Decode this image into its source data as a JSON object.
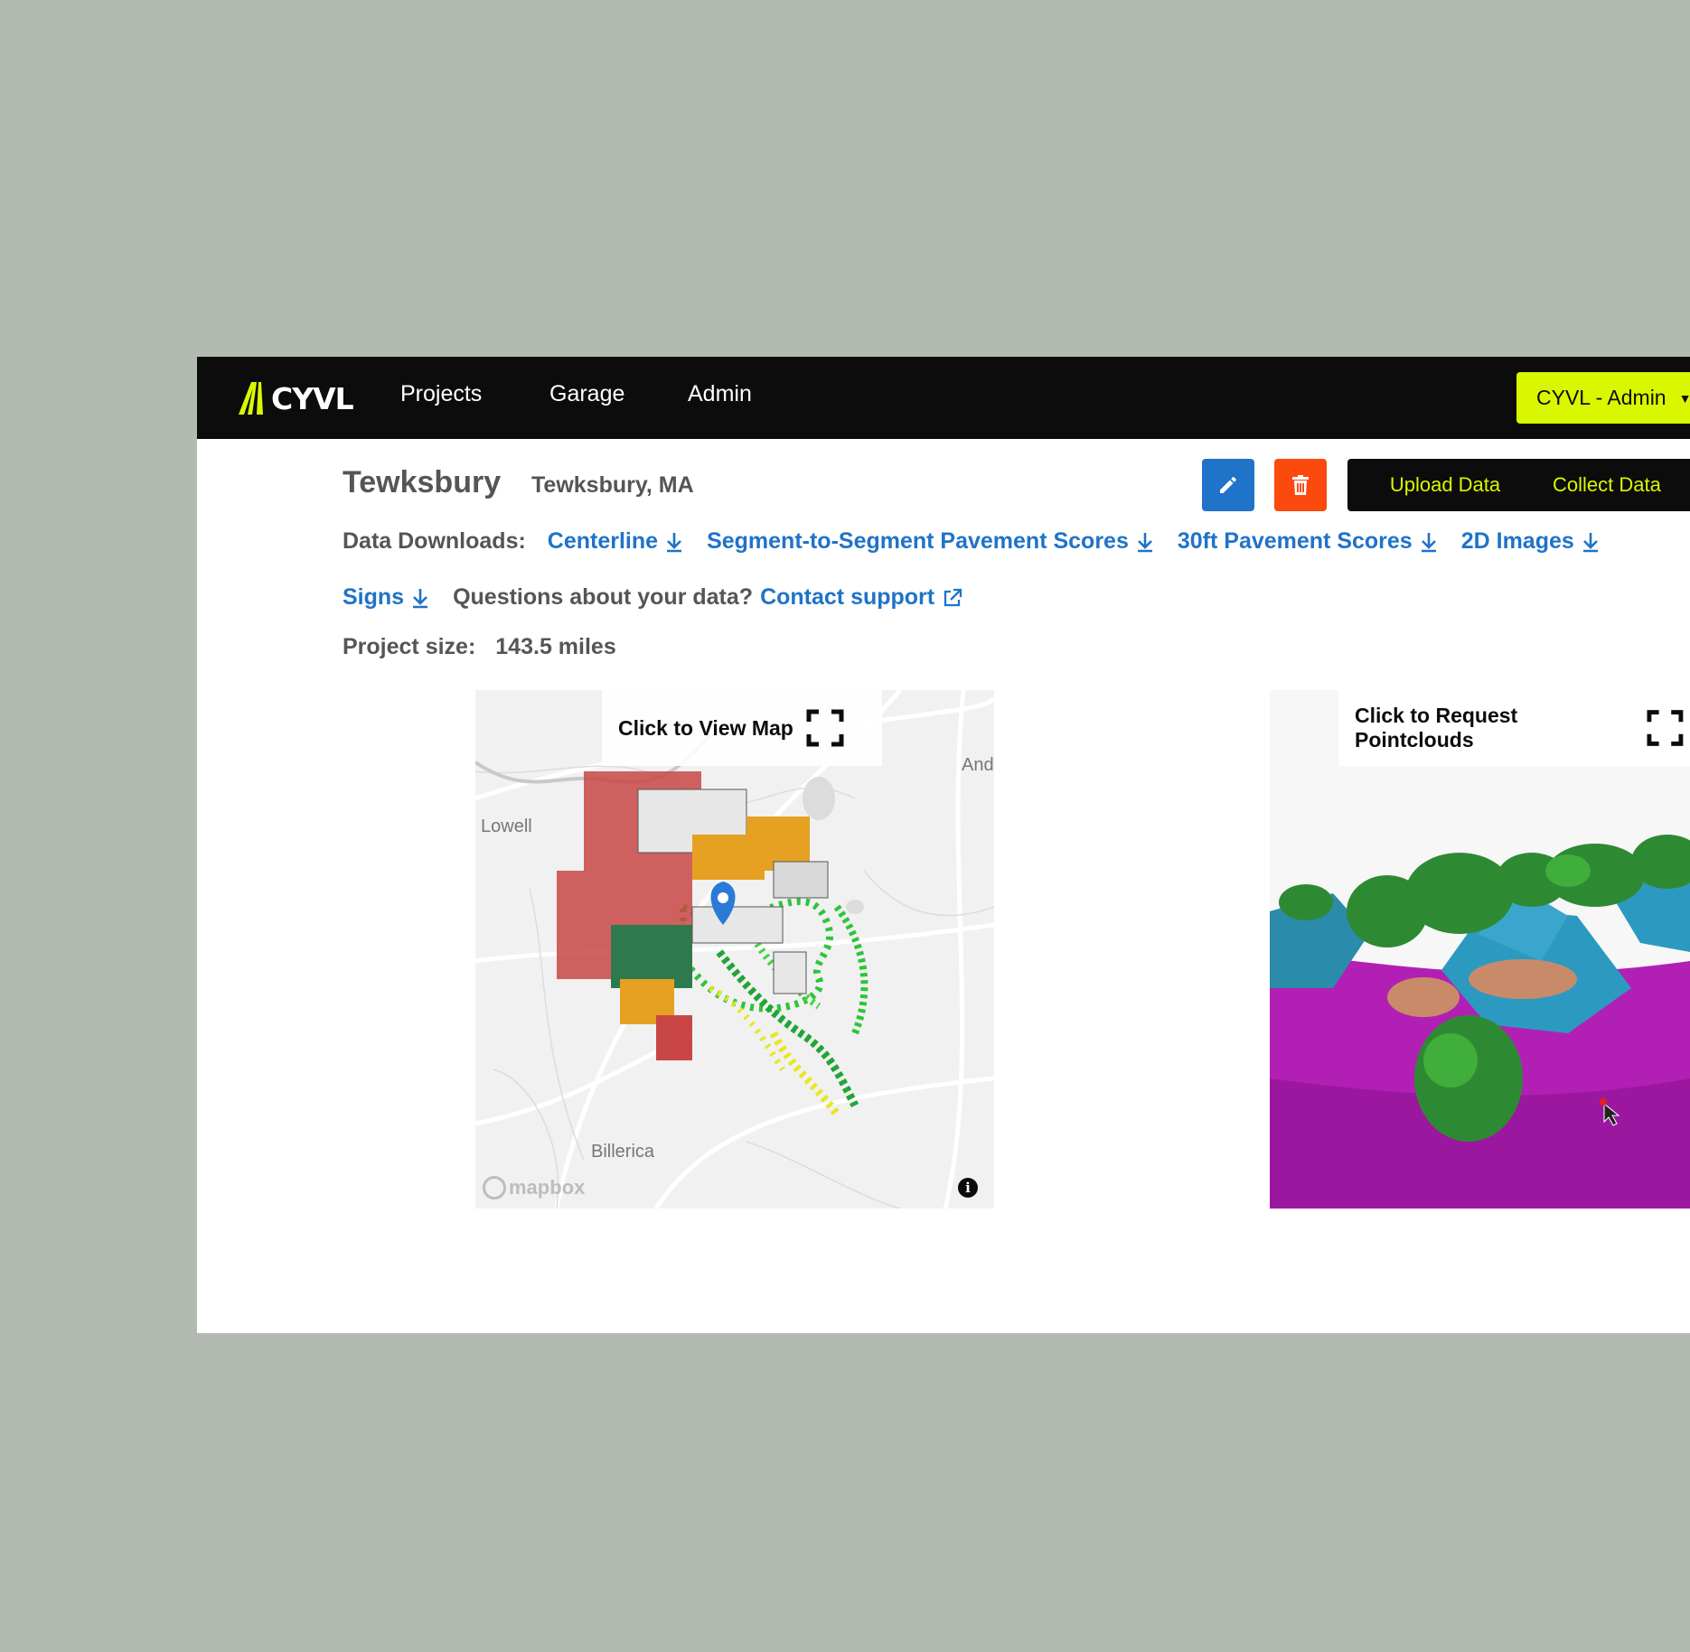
{
  "nav": {
    "logo": "CYVL",
    "links": [
      "Projects",
      "Garage",
      "Admin"
    ],
    "user_menu": "CYVL - Admin"
  },
  "project": {
    "title": "Tewksbury",
    "location": "Tewksbury, MA",
    "upload_label": "Upload Data",
    "collect_label": "Collect Data"
  },
  "downloads": {
    "label": "Data Downloads:",
    "items": [
      "Centerline",
      "Segment-to-Segment Pavement Scores",
      "30ft Pavement Scores",
      "2D Images",
      "Signs"
    ],
    "question": "Questions about your data?",
    "support_link": "Contact support"
  },
  "project_size": {
    "label": "Project size:",
    "value": "143.5 miles"
  },
  "map": {
    "cta": "Click to View Map",
    "places": [
      "Lowell",
      "Ando",
      "Billerica"
    ],
    "attribution": "mapbox"
  },
  "pointcloud": {
    "cta": "Click to Request Pointclouds"
  },
  "colors": {
    "brand_lime": "#d9f800",
    "link_blue": "#1f73c8",
    "delete_orange": "#fc4a0f",
    "nav_black": "#0c0c0c"
  }
}
